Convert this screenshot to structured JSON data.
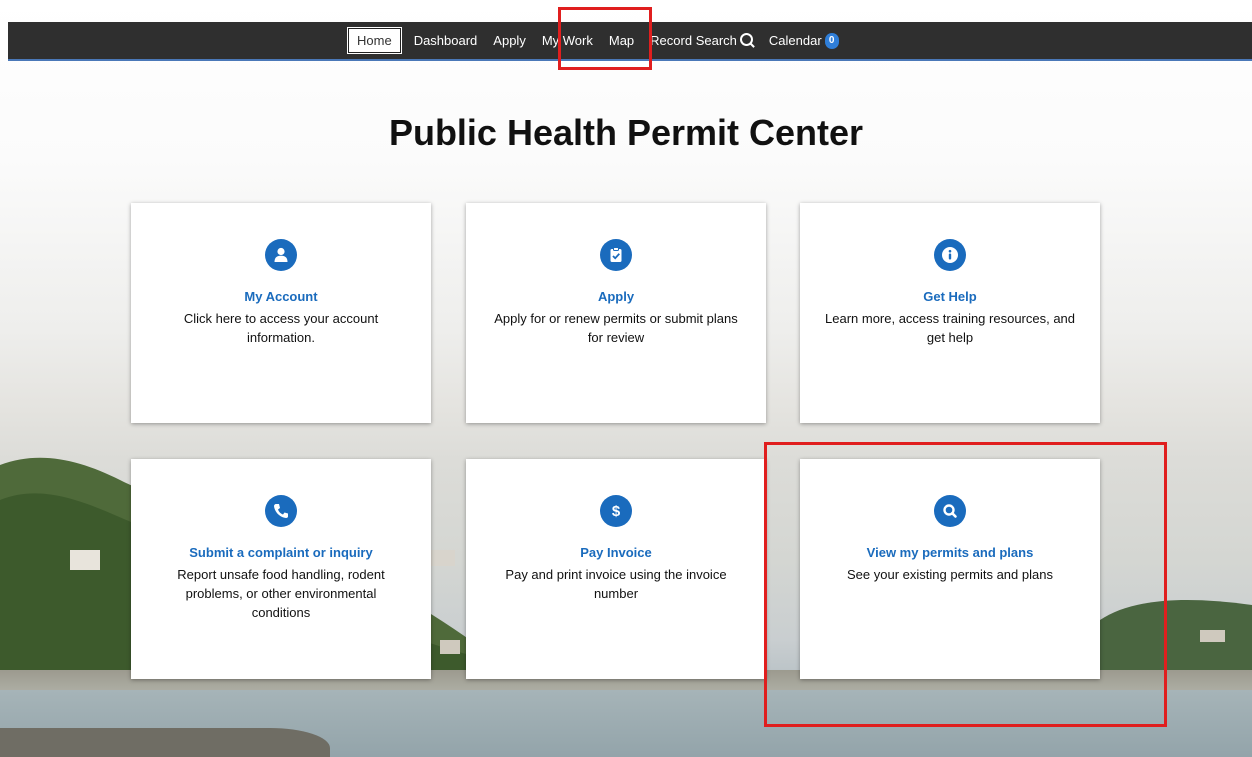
{
  "nav": {
    "items": [
      {
        "label": "Home"
      },
      {
        "label": "Dashboard"
      },
      {
        "label": "Apply"
      },
      {
        "label": "My Work"
      },
      {
        "label": "Map"
      },
      {
        "label": "Record Search"
      },
      {
        "label": "Calendar",
        "badge": "0"
      }
    ]
  },
  "page": {
    "title": "Public Health Permit Center"
  },
  "cards": [
    {
      "title": "My Account",
      "description": "Click here to access your account information.",
      "icon": "user-icon"
    },
    {
      "title": "Apply",
      "description": "Apply for or renew permits or submit plans for review",
      "icon": "clipboard-check-icon"
    },
    {
      "title": "Get Help",
      "description": "Learn more, access training resources, and get help",
      "icon": "info-icon"
    },
    {
      "title": "Submit a complaint or inquiry",
      "description": "Report unsafe food handling, rodent problems, or other environmental conditions",
      "icon": "phone-icon"
    },
    {
      "title": "Pay Invoice",
      "description": "Pay and print invoice using the invoice number",
      "icon": "dollar-icon"
    },
    {
      "title": "View my permits and plans",
      "description": "See your existing permits and plans",
      "icon": "search-icon"
    }
  ],
  "colors": {
    "accent": "#1a6bbd",
    "nav_bg": "#2f2f2f",
    "highlight": "#e01e1e"
  }
}
